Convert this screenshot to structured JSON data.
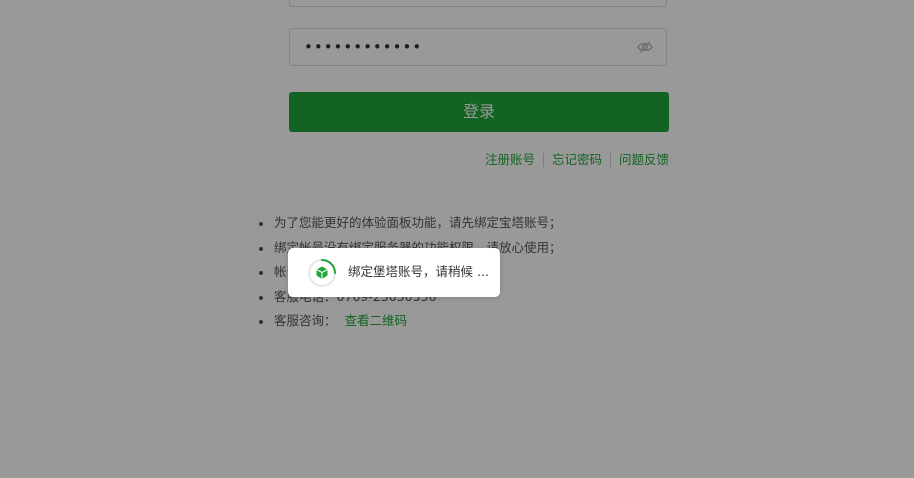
{
  "login": {
    "password_value": "••••••••••••",
    "login_button": "登录"
  },
  "links": {
    "register": "注册账号",
    "forgot_password": "忘记密码",
    "feedback": "问题反馈"
  },
  "notes": {
    "item1": "为了您能更好的体验面板功能，请先绑定宝塔账号；",
    "item2": "绑定帐号没有绑定服务器的功能权限，请放心使用；",
    "item3": "帐号",
    "item4": "客服电话：0769-23030556",
    "item5_prefix": "客服咨询：",
    "item5_link": "查看二维码"
  },
  "toast": {
    "message": "绑定堡塔账号，请稍候 ..."
  },
  "colors": {
    "accent": "#20a53a",
    "overlay": "rgba(0,0,0,0.4)"
  },
  "icons": {
    "password_toggle": "eye-icon",
    "loading": "bt-logo-spinner-icon"
  }
}
